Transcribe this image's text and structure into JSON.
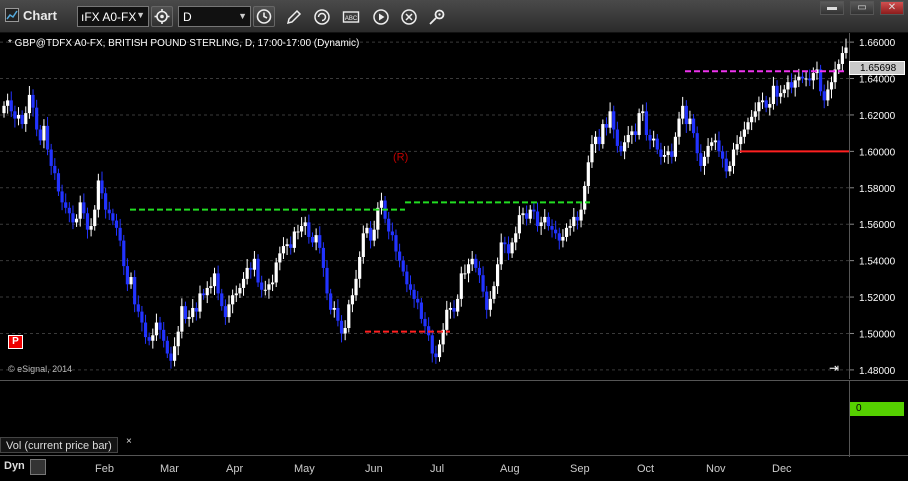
{
  "toolbar": {
    "title": "Chart",
    "symbol": "ıFX A0-FX",
    "interval": "D",
    "icons": [
      "chart-app-icon",
      "symbol-dropdown-icon",
      "link-settings-icon",
      "interval-dropdown-icon",
      "clock-icon",
      "pencil-icon",
      "refresh-icon",
      "cursor-box-icon",
      "play-icon",
      "close-circle-icon",
      "settings-icon"
    ],
    "window_buttons": [
      "minimize",
      "maximize",
      "close"
    ]
  },
  "chart": {
    "title": "* GBP@TDFX A0-FX, BRITISH POUND STERLING, D, 17:00-17:00 (Dynamic)",
    "copyright": "© eSignal, 2014",
    "badge": "P",
    "last_price": "1.65698",
    "price_ticks": [
      "1.66000",
      "1.64000",
      "1.62000",
      "1.60000",
      "1.58000",
      "1.56000",
      "1.54000",
      "1.52000",
      "1.50000",
      "1.48000"
    ],
    "months": [
      "Feb",
      "Mar",
      "Apr",
      "May",
      "Jun",
      "Jul",
      "Aug",
      "Sep",
      "Oct",
      "Nov",
      "Dec"
    ],
    "r_marker": "(R)"
  },
  "volume": {
    "label": "Vol (current price bar)",
    "close_glyph": "×",
    "value": "0",
    "value_color": "#55d000"
  },
  "footer": {
    "dyn_label": "Dyn"
  },
  "colors": {
    "up": "#ffffff",
    "down": "#2233ff",
    "support": "#ff2020",
    "resistance": "#22dd22",
    "magenta": "#ee33ee"
  },
  "chart_data": {
    "type": "candlestick",
    "ylim": [
      1.475,
      1.665
    ],
    "ticks": [
      1.66,
      1.64,
      1.62,
      1.6,
      1.58,
      1.56,
      1.54,
      1.52,
      1.5,
      1.48
    ],
    "close": [
      1.625,
      1.628,
      1.622,
      1.618,
      1.62,
      1.615,
      1.621,
      1.631,
      1.624,
      1.612,
      1.606,
      1.614,
      1.601,
      1.592,
      1.588,
      1.578,
      1.572,
      1.569,
      1.566,
      1.561,
      1.563,
      1.572,
      1.566,
      1.557,
      1.559,
      1.568,
      1.584,
      1.577,
      1.568,
      1.566,
      1.562,
      1.558,
      1.551,
      1.537,
      1.527,
      1.531,
      1.516,
      1.512,
      1.506,
      1.498,
      1.496,
      1.499,
      1.506,
      1.502,
      1.496,
      1.489,
      1.485,
      1.493,
      1.501,
      1.515,
      1.508,
      1.509,
      1.514,
      1.512,
      1.522,
      1.521,
      1.525,
      1.526,
      1.533,
      1.522,
      1.515,
      1.509,
      1.516,
      1.521,
      1.522,
      1.525,
      1.53,
      1.536,
      1.535,
      1.541,
      1.528,
      1.524,
      1.524,
      1.527,
      1.528,
      1.539,
      1.544,
      1.548,
      1.549,
      1.547,
      1.556,
      1.556,
      1.559,
      1.561,
      1.553,
      1.55,
      1.554,
      1.547,
      1.536,
      1.522,
      1.513,
      1.514,
      1.507,
      1.5,
      1.503,
      1.516,
      1.521,
      1.53,
      1.542,
      1.555,
      1.558,
      1.551,
      1.557,
      1.569,
      1.573,
      1.563,
      1.556,
      1.554,
      1.545,
      1.54,
      1.534,
      1.527,
      1.524,
      1.519,
      1.517,
      1.508,
      1.504,
      1.499,
      1.489,
      1.487,
      1.494,
      1.502,
      1.513,
      1.514,
      1.512,
      1.519,
      1.533,
      1.533,
      1.538,
      1.541,
      1.536,
      1.532,
      1.523,
      1.513,
      1.519,
      1.526,
      1.538,
      1.55,
      1.549,
      1.544,
      1.55,
      1.555,
      1.565,
      1.566,
      1.563,
      1.568,
      1.567,
      1.559,
      1.561,
      1.564,
      1.559,
      1.557,
      1.555,
      1.551,
      1.553,
      1.558,
      1.559,
      1.564,
      1.562,
      1.568,
      1.581,
      1.594,
      1.604,
      1.608,
      1.604,
      1.615,
      1.613,
      1.622,
      1.612,
      1.603,
      1.6,
      1.605,
      1.609,
      1.611,
      1.609,
      1.621,
      1.622,
      1.609,
      1.606,
      1.607,
      1.601,
      1.597,
      1.598,
      1.6,
      1.597,
      1.608,
      1.618,
      1.625,
      1.615,
      1.618,
      1.61,
      1.599,
      1.592,
      1.597,
      1.603,
      1.605,
      1.606,
      1.6,
      1.596,
      1.589,
      1.592,
      1.601,
      1.604,
      1.608,
      1.612,
      1.616,
      1.619,
      1.622,
      1.627,
      1.628,
      1.624,
      1.626,
      1.636,
      1.63,
      1.632,
      1.634,
      1.638,
      1.635,
      1.639,
      1.641,
      1.64,
      1.64,
      1.639,
      1.643,
      1.645,
      1.633,
      1.628,
      1.634,
      1.638,
      1.645,
      1.648,
      1.654,
      1.657
    ]
  }
}
